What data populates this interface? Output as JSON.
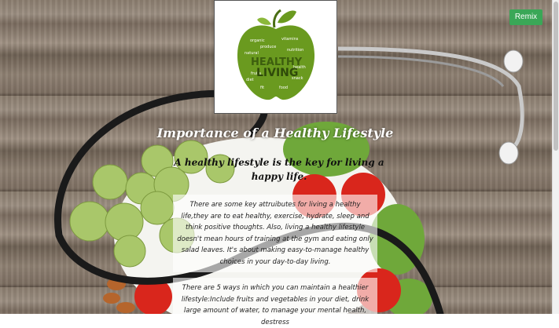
{
  "header": {
    "remix_label": "Remix"
  },
  "logo": {
    "line1": "HEALTHY",
    "line2": "LIVING",
    "words": [
      "organic",
      "vitamins",
      "produce",
      "natural",
      "nutrition",
      "diet",
      "snack",
      "food",
      "fit",
      "fruits",
      "health"
    ]
  },
  "content": {
    "title": "Importance of a Healthy Lifestyle",
    "subtitle": "A healthy lifestyle is the key for living a happy life.",
    "paragraph1": "There are some key attruibutes for living a healthy life,they are to eat healthy, exercise, hydrate, sleep and think positive thoughts. Also, living a healthy lifestyle doesn't mean hours of training at the gym and eating only salad leaves. It's about making easy-to-manage healthy choices in your day-to-day living.",
    "paragraph2": "There are 5 ways in which you can maintain a healthier lifestyle:Include fruits and vegetables in your diet, drink large amount of water, to manage your mental health, destress"
  },
  "colors": {
    "remix": "#3aa757",
    "apple_green": "#6a9a1f"
  }
}
